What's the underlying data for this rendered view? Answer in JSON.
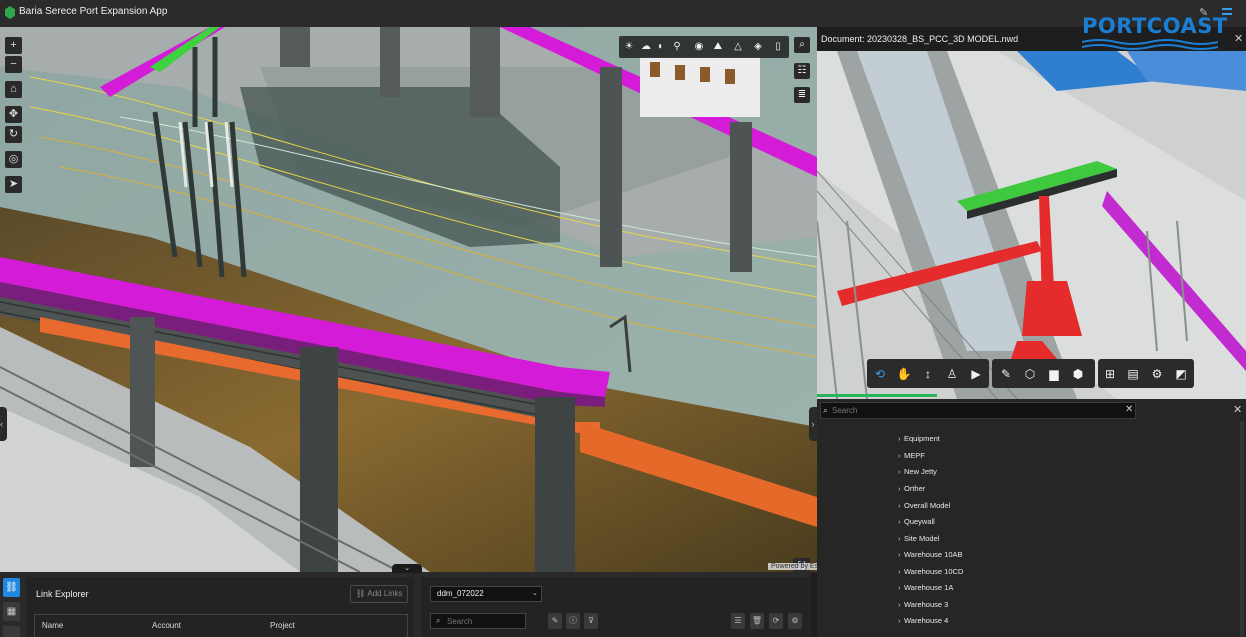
{
  "app": {
    "title": "Baria Serece Port Expansion App",
    "accent_color": "#1f88e0",
    "brand_color": "#1a7ed3"
  },
  "icons": {
    "app_logo": "hexagon-logo-icon",
    "edit": "pencil-icon",
    "menu": "hamburger-menu-icon"
  },
  "map_tools": [
    {
      "name": "zoom-in-icon",
      "glyph": "+"
    },
    {
      "name": "zoom-out-icon",
      "glyph": "−"
    },
    {
      "name": "home-icon",
      "glyph": "⌂"
    },
    {
      "name": "pan-icon",
      "glyph": "✥"
    },
    {
      "name": "rotate-icon",
      "glyph": "↻"
    },
    {
      "name": "compass-icon",
      "glyph": "◎"
    },
    {
      "name": "north-arrow-icon",
      "glyph": "➤"
    }
  ],
  "viewer_top_tools": [
    {
      "name": "daylight-icon",
      "glyph": "☀"
    },
    {
      "name": "weather-icon",
      "glyph": "☁"
    },
    {
      "name": "layers-icon",
      "glyph": "◐"
    },
    {
      "name": "measure-icon",
      "glyph": "⚲"
    },
    {
      "name": "basemap-icon",
      "glyph": "◉"
    },
    {
      "name": "elevation-icon",
      "glyph": "⛰"
    },
    {
      "name": "slice-icon",
      "glyph": "△"
    },
    {
      "name": "line-of-sight-icon",
      "glyph": "◈"
    },
    {
      "name": "bookmark-icon",
      "glyph": "▯"
    }
  ],
  "viewer_right_tools": [
    {
      "name": "search-icon",
      "glyph": "⌕"
    },
    {
      "name": "legend-icon",
      "glyph": "☷"
    },
    {
      "name": "layer-list-icon",
      "glyph": "≣"
    }
  ],
  "viewer": {
    "powered_by": "Powered by Esri",
    "expand_glyph": "⛶",
    "left_collapse_glyph": "‹",
    "right_collapse_glyph": "›"
  },
  "document": {
    "title": "Document: 20230328_BS_PCC_3D MODEL.nwd",
    "close_glyph": "✕",
    "brand": "PORTCOAST"
  },
  "nav_toolbar": [
    {
      "name": "orbit-icon",
      "glyph": "⟲"
    },
    {
      "name": "hand-pan-icon",
      "glyph": "✋"
    },
    {
      "name": "vertical-move-icon",
      "glyph": "↕"
    },
    {
      "name": "walk-icon",
      "glyph": "🚶"
    },
    {
      "name": "camera-icon",
      "glyph": "▶"
    },
    {
      "name": "measure-pencil-icon",
      "glyph": "✎"
    },
    {
      "name": "section-box-icon",
      "glyph": "⬡"
    },
    {
      "name": "folder-icon",
      "glyph": "▆"
    },
    {
      "name": "model-cube-icon",
      "glyph": "⬢"
    },
    {
      "name": "model-tree-icon",
      "glyph": "⊞"
    },
    {
      "name": "properties-icon",
      "glyph": "▤"
    },
    {
      "name": "settings-icon",
      "glyph": "⚙"
    },
    {
      "name": "fullscreen-icon",
      "glyph": "◩"
    }
  ],
  "tree": {
    "search_placeholder": "Search",
    "clear_glyph": "✕",
    "close_glyph": "✕",
    "items": [
      {
        "label": "Equipment"
      },
      {
        "label": "MEPF"
      },
      {
        "label": "New Jetty"
      },
      {
        "label": "Orther"
      },
      {
        "label": "Overall Model"
      },
      {
        "label": "Queywall"
      },
      {
        "label": "Site Model"
      },
      {
        "label": "Warehouse 10AB"
      },
      {
        "label": "Warehouse 10CD"
      },
      {
        "label": "Warehouse 1A"
      },
      {
        "label": "Warehouse 3"
      },
      {
        "label": "Warehouse 4"
      }
    ]
  },
  "link_explorer": {
    "title": "Link Explorer",
    "add_links": "Add Links",
    "columns": [
      "Name",
      "Account",
      "Project"
    ]
  },
  "models": {
    "selected": "ddm_072022",
    "search_placeholder": "Search"
  },
  "bottom_collapse_glyph": "⌄"
}
